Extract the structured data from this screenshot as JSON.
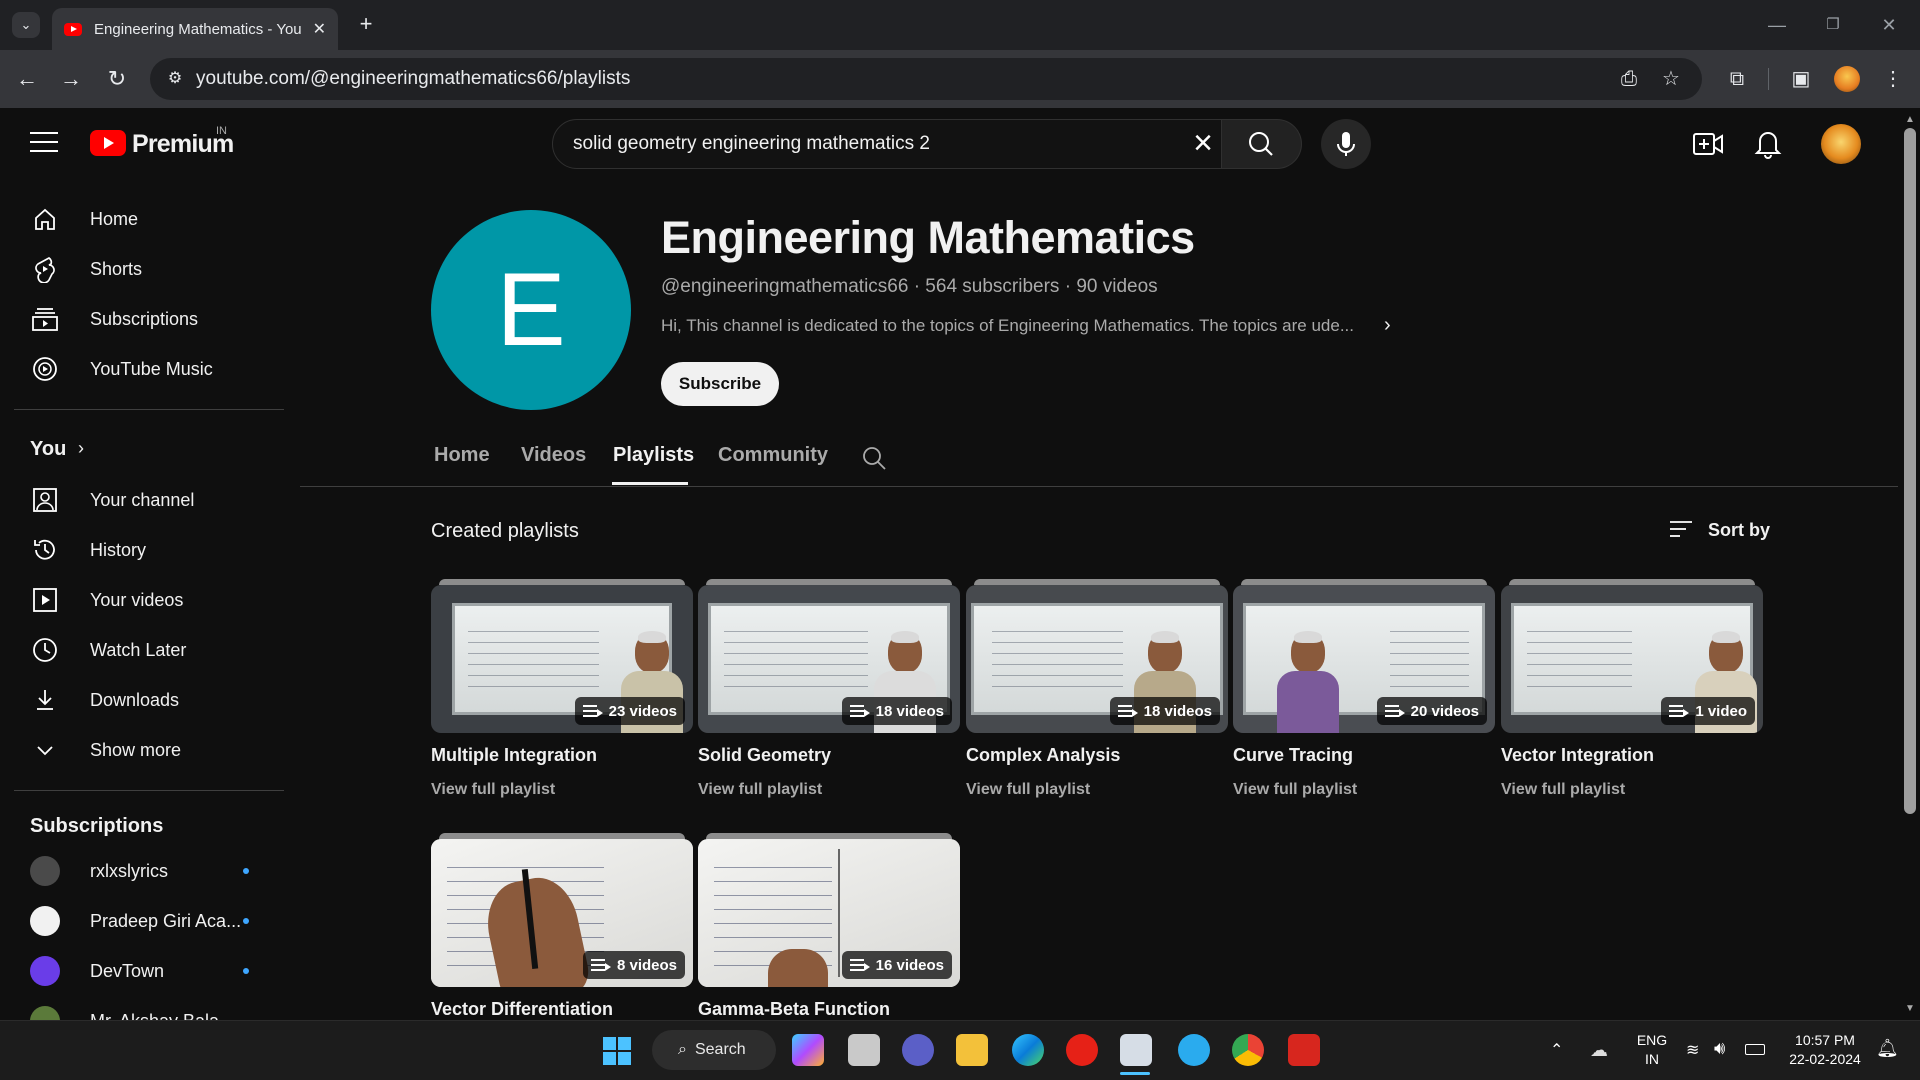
{
  "browser": {
    "tab_title": "Engineering Mathematics - You",
    "url": "youtube.com/@engineeringmathematics66/playlists"
  },
  "masthead": {
    "logo_text": "Premium",
    "region": "IN",
    "search_value": "solid geometry engineering mathematics 2"
  },
  "sidebar": {
    "main": [
      {
        "label": "Home",
        "icon": "home-icon"
      },
      {
        "label": "Shorts",
        "icon": "shorts-icon"
      },
      {
        "label": "Subscriptions",
        "icon": "subscriptions-icon"
      },
      {
        "label": "YouTube Music",
        "icon": "youtube-music-icon"
      }
    ],
    "you_label": "You",
    "you": [
      {
        "label": "Your channel",
        "icon": "your-channel-icon"
      },
      {
        "label": "History",
        "icon": "history-icon"
      },
      {
        "label": "Your videos",
        "icon": "your-videos-icon"
      },
      {
        "label": "Watch Later",
        "icon": "watch-later-icon"
      },
      {
        "label": "Downloads",
        "icon": "downloads-icon"
      },
      {
        "label": "Show more",
        "icon": "chevron-down-icon"
      }
    ],
    "subscriptions_label": "Subscriptions",
    "subscriptions": [
      {
        "name": "rxlxslyrics",
        "color": "#4a4a4a"
      },
      {
        "name": "Pradeep Giri Aca...",
        "color": "#ffffff"
      },
      {
        "name": "DevTown",
        "color": "#6a3de8"
      },
      {
        "name": "Mr. Akshay Bala...",
        "color": "#5b7a3a"
      }
    ]
  },
  "channel": {
    "avatar_letter": "E",
    "avatar_color": "#0097a7",
    "name": "Engineering Mathematics",
    "meta": "@engineeringmathematics66 · 564 subscribers · 90 videos",
    "description": "Hi, This channel is dedicated to the topics of Engineering Mathematics. The topics are ude...",
    "subscribe_label": "Subscribe",
    "tabs": [
      "Home",
      "Videos",
      "Playlists",
      "Community"
    ],
    "active_tab": "Playlists"
  },
  "playlists_section": {
    "title": "Created playlists",
    "sort_label": "Sort by",
    "view_label": "View full playlist",
    "items": [
      {
        "title": "Multiple Integration",
        "count": "23 videos"
      },
      {
        "title": "Solid Geometry",
        "count": "18 videos"
      },
      {
        "title": "Complex Analysis",
        "count": "18 videos"
      },
      {
        "title": "Curve Tracing",
        "count": "20 videos"
      },
      {
        "title": "Vector Integration",
        "count": "1 video"
      },
      {
        "title": "Vector Differentiation",
        "count": "8 videos"
      },
      {
        "title": "Gamma-Beta Function",
        "count": "16 videos"
      }
    ]
  },
  "taskbar": {
    "search_label": "Search",
    "lang": "ENG",
    "region": "IN",
    "time": "10:57 PM",
    "date": "22-02-2024"
  }
}
